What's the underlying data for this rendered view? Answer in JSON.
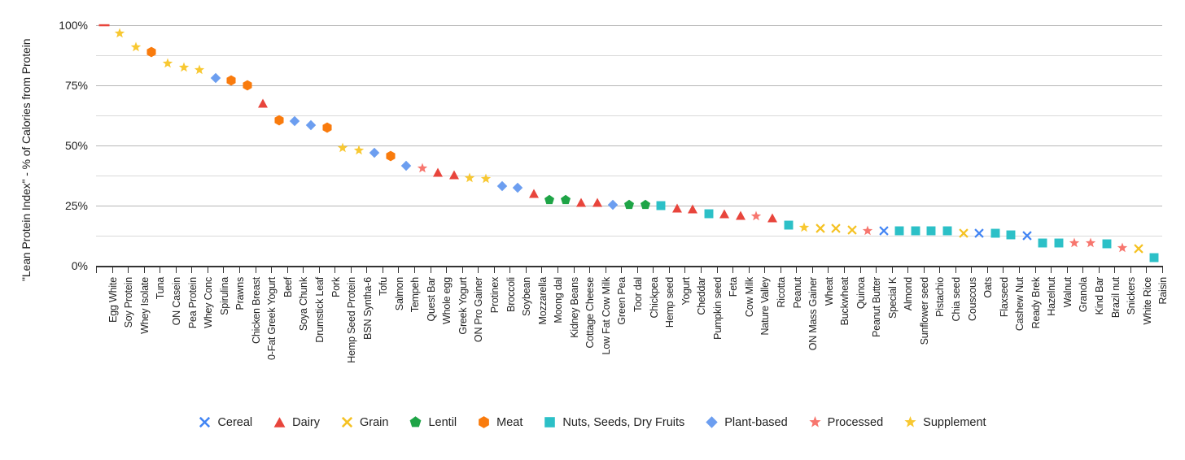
{
  "chart_data": {
    "type": "scatter",
    "title": "",
    "xlabel": "",
    "ylabel": "\"Lean Protein Index\" - % of Calories from Protein",
    "ylim": [
      0,
      100
    ],
    "ytick_labels": [
      "0%",
      "25%",
      "50%",
      "75%",
      "100%"
    ],
    "ytick_values": [
      0,
      25,
      50,
      75,
      100
    ],
    "minor_gridline_step": 12.5,
    "grid": true,
    "legend_position": "bottom",
    "categories": [
      "Egg White",
      "Soy Protein",
      "Whey Isolate",
      "Tuna",
      "ON Casein",
      "Pea Protein",
      "Whey Conc",
      "Spirulina",
      "Prawns",
      "Chicken Breast",
      "0-Fat Greek Yogurt",
      "Beef",
      "Soya Chunk",
      "Drumstick Leaf",
      "Pork",
      "Hemp Seed Protein",
      "BSN Syntha-6",
      "Tofu",
      "Salmon",
      "Tempeh",
      "Quest Bar",
      "Whole egg",
      "Greek Yogurt",
      "ON Pro Gainer",
      "Protinex",
      "Broccoli",
      "Soybean",
      "Mozzarella",
      "Moong dal",
      "Kidney Beans",
      "Cottage Cheese",
      "Low Fat Cow Milk",
      "Green Pea",
      "Toor dal",
      "Chickpea",
      "Hemp seed",
      "Yogurt",
      "Cheddar",
      "Pumpkin seed",
      "Feta",
      "Cow Milk",
      "Nature Valley",
      "Ricotta",
      "Peanut",
      "ON Mass Gainer",
      "Wheat",
      "Buckwheat",
      "Quinoa",
      "Peanut Butter",
      "Special K",
      "Almond",
      "Sunflower seed",
      "Pistachio",
      "Chia seed",
      "Couscous",
      "Oats",
      "Flaxseed",
      "Cashew Nut",
      "Ready Brek",
      "Hazelnut",
      "Walnut",
      "Granola",
      "Kind Bar",
      "Brazil nut",
      "Snickers",
      "White Rice",
      "Raisin"
    ],
    "values": [
      100,
      96.5,
      91,
      89,
      84,
      82.5,
      81.5,
      78,
      77,
      75,
      67.5,
      60.5,
      60,
      58.5,
      57.5,
      49,
      48,
      47,
      45.5,
      41.5,
      40.5,
      39,
      38,
      36.5,
      36,
      33,
      32.5,
      30,
      27.5,
      27.5,
      26.5,
      26.5,
      25.5,
      25.5,
      25.5,
      25,
      24,
      23.5,
      21.5,
      21.5,
      21,
      20.5,
      20,
      17,
      16,
      15.5,
      15.5,
      15,
      14.5,
      14.5,
      14.5,
      14.5,
      14.5,
      14.5,
      13.5,
      13.5,
      13.5,
      13,
      12.5,
      9.5,
      9.5,
      9.5,
      9.5,
      9,
      7.5,
      7,
      3.5
    ],
    "series_of_point": [
      "Processed",
      "Supplement",
      "Supplement",
      "Meat",
      "Supplement",
      "Supplement",
      "Supplement",
      "Plant-based",
      "Meat",
      "Meat",
      "Dairy",
      "Meat",
      "Plant-based",
      "Plant-based",
      "Meat",
      "Supplement",
      "Supplement",
      "Plant-based",
      "Meat",
      "Plant-based",
      "Processed",
      "Dairy",
      "Dairy",
      "Supplement",
      "Supplement",
      "Plant-based",
      "Plant-based",
      "Dairy",
      "Lentil",
      "Lentil",
      "Dairy",
      "Dairy",
      "Plant-based",
      "Lentil",
      "Lentil",
      "Nuts, Seeds, Dry Fruits",
      "Dairy",
      "Dairy",
      "Nuts, Seeds, Dry Fruits",
      "Dairy",
      "Dairy",
      "Processed",
      "Dairy",
      "Nuts, Seeds, Dry Fruits",
      "Supplement",
      "Grain",
      "Grain",
      "Grain",
      "Processed",
      "Cereal",
      "Nuts, Seeds, Dry Fruits",
      "Nuts, Seeds, Dry Fruits",
      "Nuts, Seeds, Dry Fruits",
      "Nuts, Seeds, Dry Fruits",
      "Grain",
      "Cereal",
      "Nuts, Seeds, Dry Fruits",
      "Nuts, Seeds, Dry Fruits",
      "Cereal",
      "Nuts, Seeds, Dry Fruits",
      "Nuts, Seeds, Dry Fruits",
      "Processed",
      "Processed",
      "Nuts, Seeds, Dry Fruits",
      "Processed",
      "Grain",
      "Nuts, Seeds, Dry Fruits"
    ],
    "series": [
      {
        "name": "Cereal",
        "marker": "x",
        "color": "#4285f4"
      },
      {
        "name": "Dairy",
        "marker": "triangle",
        "color": "#e8453c"
      },
      {
        "name": "Grain",
        "marker": "x",
        "color": "#f5c223"
      },
      {
        "name": "Lentil",
        "marker": "pentagon",
        "color": "#1ea446"
      },
      {
        "name": "Meat",
        "marker": "hexagon",
        "color": "#f97b0d"
      },
      {
        "name": "Nuts, Seeds, Dry Fruits",
        "marker": "square",
        "color": "#2cc0c7"
      },
      {
        "name": "Plant-based",
        "marker": "diamond",
        "color": "#6c9ef0"
      },
      {
        "name": "Processed",
        "marker": "star",
        "color": "#f7766e"
      },
      {
        "name": "Supplement",
        "marker": "star",
        "color": "#f8c831"
      }
    ]
  }
}
